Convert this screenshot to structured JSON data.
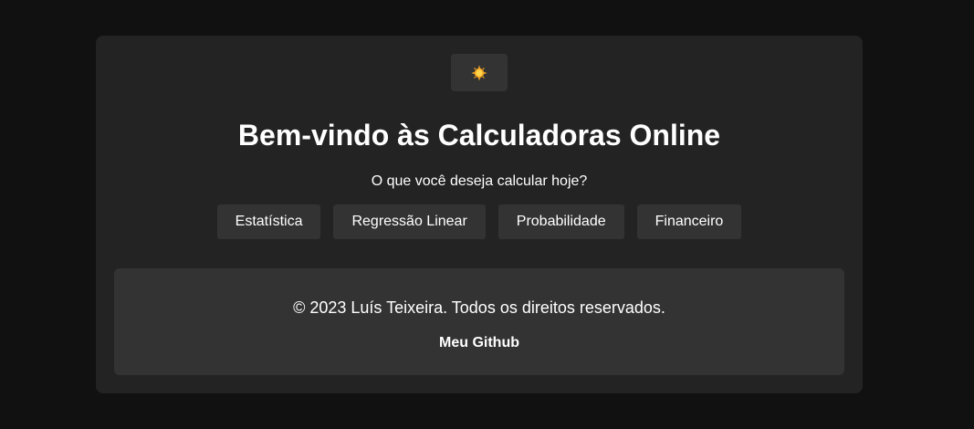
{
  "theme_toggle": {
    "icon": "sun-icon",
    "color": "#f5a623"
  },
  "header": {
    "title": "Bem-vindo às Calculadoras Online",
    "subtitle": "O que você deseja calcular hoje?"
  },
  "nav": {
    "items": [
      {
        "label": "Estatística"
      },
      {
        "label": "Regressão Linear"
      },
      {
        "label": "Probabilidade"
      },
      {
        "label": "Financeiro"
      }
    ]
  },
  "footer": {
    "copyright": "© 2023 Luís Teixeira. Todos os direitos reservados.",
    "github_label": "Meu Github"
  }
}
